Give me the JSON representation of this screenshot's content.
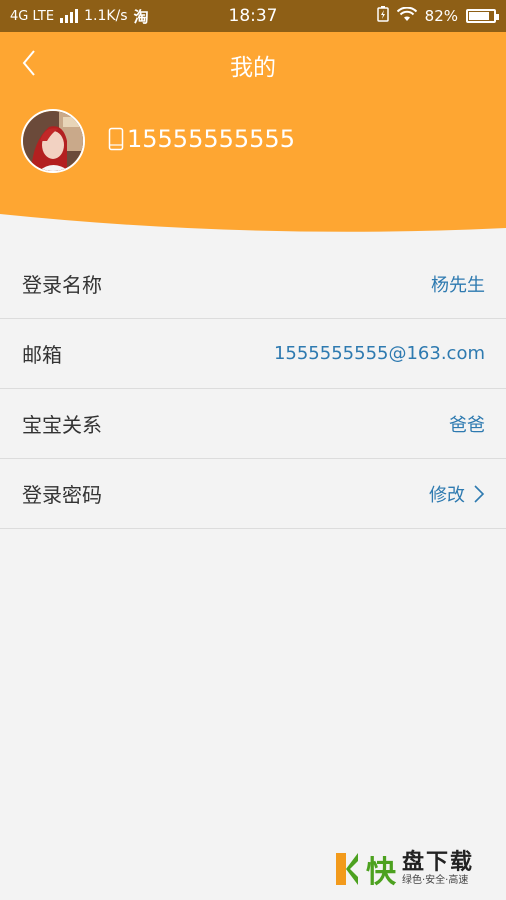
{
  "status_bar": {
    "network": "4G LTE",
    "speed": "1.1K/s",
    "taobao": "淘",
    "time": "18:37",
    "battery": "82%",
    "battery_level": 0.82
  },
  "header": {
    "title": "我的",
    "phone": "15555555555",
    "colors": {
      "accent": "#fea632",
      "status_bar": "#8e5f16",
      "value_text": "#2e7ab0"
    }
  },
  "rows": [
    {
      "label": "登录名称",
      "value": "杨先生"
    },
    {
      "label": "邮箱",
      "value": "1555555555@163.com"
    },
    {
      "label": "宝宝关系",
      "value": "爸爸"
    },
    {
      "label": "登录密码",
      "value": "修改"
    }
  ],
  "watermark": {
    "kuai": "快",
    "main": "盘下载",
    "sub": "绿色·安全·高速"
  },
  "icons": [
    "back-icon",
    "phone-icon",
    "chevron-right-icon",
    "wifi-icon",
    "battery-icon",
    "signal-icon"
  ]
}
